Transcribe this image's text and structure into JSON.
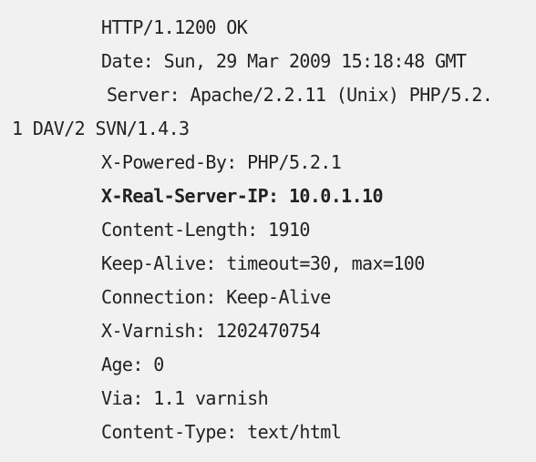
{
  "header_lines": [
    "HTTP/1.1200 OK",
    "Date: Sun, 29 Mar 2009 15:18:48 GMT",
    "Server: Apache/2.2.11 (Unix) PHP/5.2.",
    "1 DAV/2 SVN/1.4.3",
    "X-Powered-By: PHP/5.2.1",
    "X-Real-Server-IP: 10.0.1.10",
    "Content-Length: 1910",
    "Keep-Alive: timeout=30, max=100",
    "Connection: Keep-Alive",
    "X-Varnish: 1202470754",
    "Age: 0",
    "Via: 1.1 varnish",
    "Content-Type: text/html"
  ],
  "highlighted_line_index": 5
}
